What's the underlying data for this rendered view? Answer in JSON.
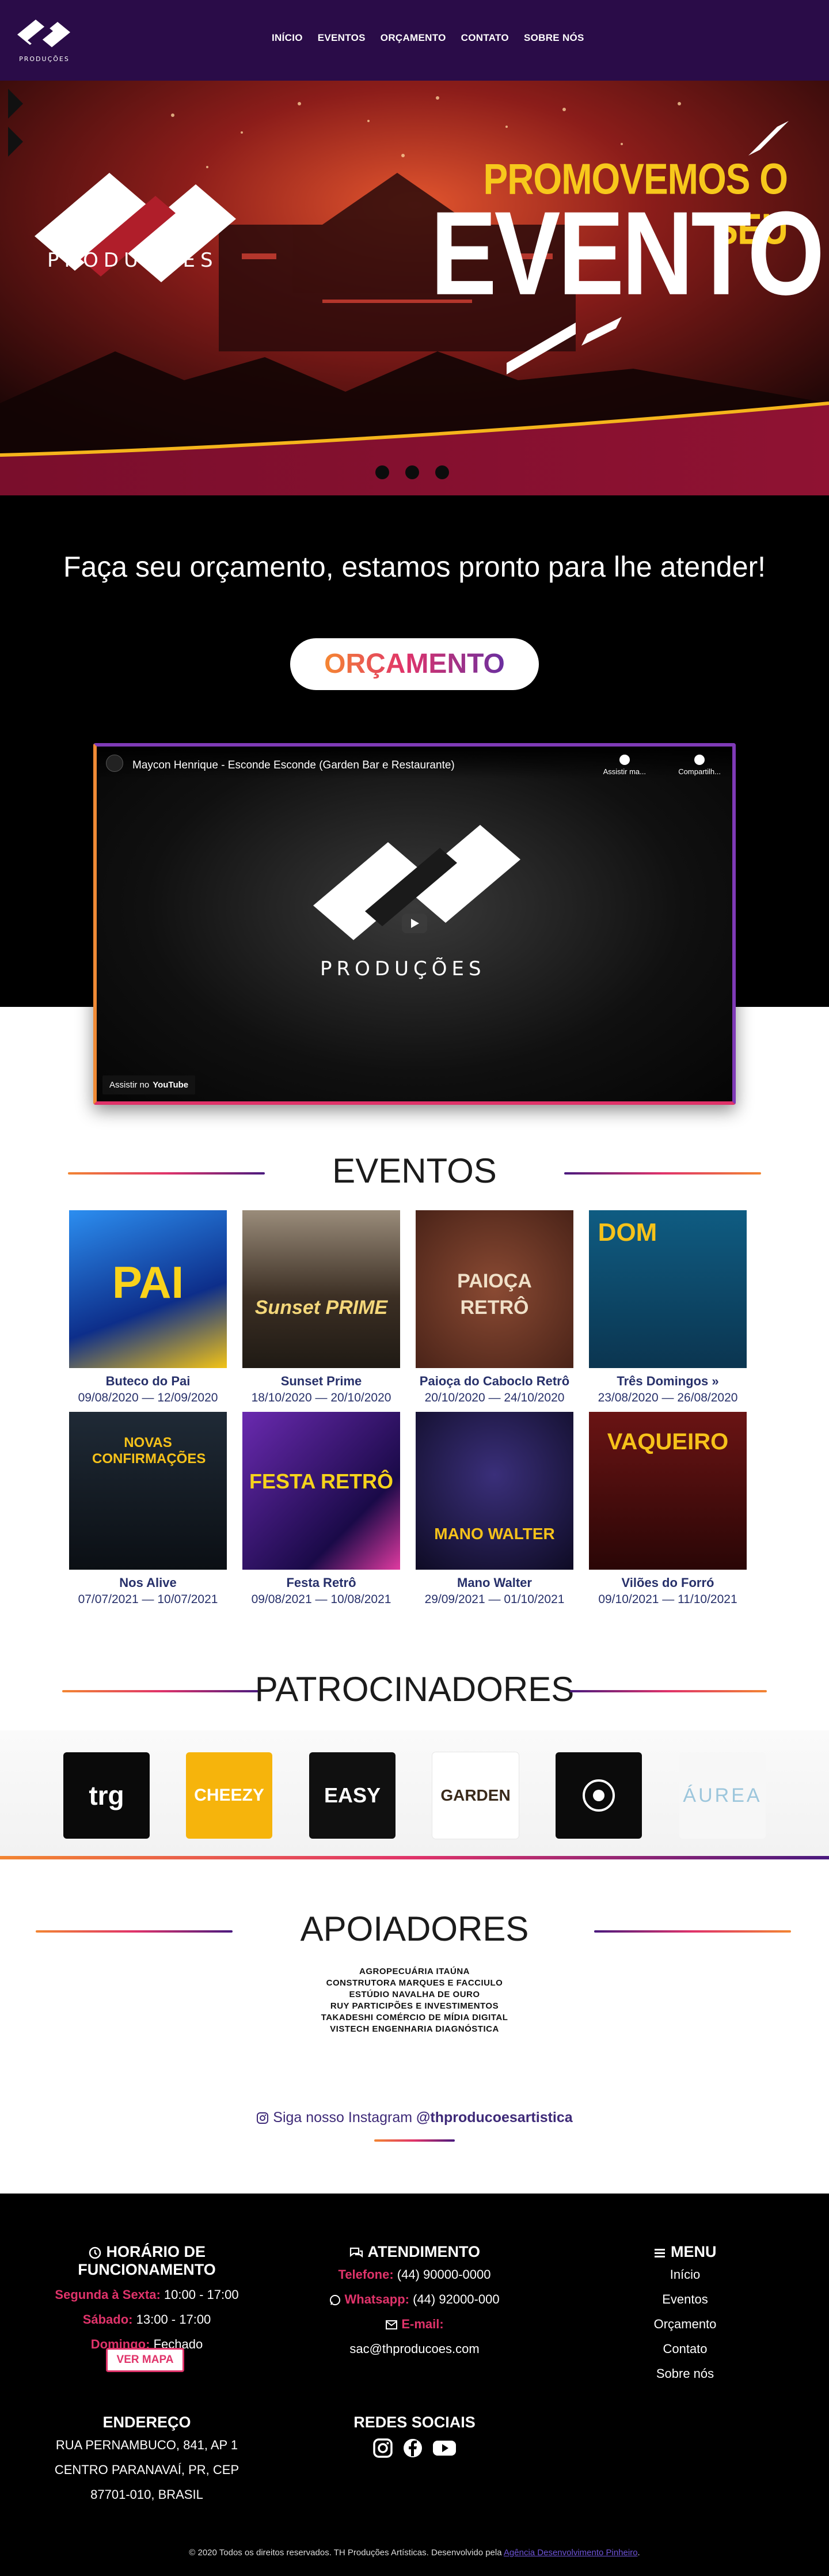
{
  "nav": {
    "logo_text": "PRODUÇÕES",
    "items": [
      "INÍCIO",
      "EVENTOS",
      "ORÇAMENTO",
      "CONTATO",
      "SOBRE NÓS"
    ]
  },
  "hero": {
    "brand": "PRODUÇÕES",
    "headline": "PROMOVEMOS O SEU",
    "headline_big": "EVENTO",
    "slides": 3
  },
  "cta": {
    "lead": "Faça seu orçamento, estamos pronto para lhe atender!",
    "button": "ORÇAMENTO"
  },
  "video": {
    "title": "Maycon Henrique - Esconde Esconde (Garden Bar e Restaurante)",
    "watch_later": "Assistir ma...",
    "share": "Compartilh...",
    "brand": "PRODUÇÕES",
    "watch_on": "Assistir no",
    "youtube": "YouTube"
  },
  "events": {
    "heading": "EVENTOS",
    "items": [
      {
        "name": "Buteco do Pai",
        "dates": "09/08/2020 — 12/09/2020",
        "poster": "PAI",
        "color": "#1f6fd0"
      },
      {
        "name": "Sunset Prime",
        "dates": "18/10/2020 — 20/10/2020",
        "poster": "Sunset PRIME",
        "color": "#4a3a2c"
      },
      {
        "name": "Paioça do Caboclo Retrô",
        "dates": "20/10/2020 — 24/10/2020",
        "poster": "PAIOÇA RETRÔ",
        "color": "#6b3a2a"
      },
      {
        "name": "Três Domingos »",
        "dates": "23/08/2020 — 26/08/2020",
        "poster": "DOM",
        "color": "#124b6b"
      },
      {
        "name": "Nos Alive",
        "dates": "07/07/2021 — 10/07/2021",
        "poster": "NOVAS CONFIRMAÇÕES",
        "color": "#15202b"
      },
      {
        "name": "Festa Retrô",
        "dates": "09/08/2021 — 10/08/2021",
        "poster": "FESTA RETRÔ",
        "color": "#3a1a6a"
      },
      {
        "name": "Mano Walter",
        "dates": "29/09/2021 — 01/10/2021",
        "poster": "MANO WALTER",
        "color": "#1a1436"
      },
      {
        "name": "Vilões do Forró",
        "dates": "09/10/2021 — 11/10/2021",
        "poster": "VAQUEIRO",
        "color": "#4a1010"
      }
    ]
  },
  "sponsors": {
    "heading": "PATROCINADORES",
    "items": [
      {
        "name": "trg",
        "bg": "#0a0a0a",
        "fg": "#ffffff"
      },
      {
        "name": "CHEEZY",
        "bg": "#f6b40c",
        "fg": "#ffffff"
      },
      {
        "name": "EASY",
        "bg": "#101010",
        "fg": "#ffffff"
      },
      {
        "name": "GARDEN",
        "bg": "#ffffff",
        "fg": "#3a2a1a"
      },
      {
        "name": "",
        "bg": "#0b0b0b",
        "fg": "#ffffff"
      },
      {
        "name": "ÁUREA",
        "bg": "#f7f7f7",
        "fg": "#9cc6dc"
      }
    ]
  },
  "supporters": {
    "heading": "APOIADORES",
    "items": [
      "AGROPECUÁRIA ITAÚNA",
      "CONSTRUTORA MARQUES E FACCIULO",
      "ESTÚDIO NAVALHA DE OURO",
      "RUY PARTICIPÕES E INVESTIMENTOS",
      "TAKADESHI COMÉRCIO DE MÍDIA DIGITAL",
      "VISTECH ENGENHARIA DIAGNÓSTICA"
    ]
  },
  "instagram": {
    "prefix": "Siga nosso Instagram",
    "handle": "@thproducoesartistica"
  },
  "footer": {
    "hours_title": "HORÁRIO DE FUNCIONAMENTO",
    "hours": [
      {
        "day": "Segunda à Sexta:",
        "time": "10:00 - 17:00"
      },
      {
        "day": "Sábado:",
        "time": "13:00 - 17:00"
      },
      {
        "day": "Domingo:",
        "time": "Fechado"
      }
    ],
    "service_title": "ATENDIMENTO",
    "phone_label": "Telefone:",
    "phone": "(44) 90000-0000",
    "whatsapp_label": "Whatsapp:",
    "whatsapp": "(44) 92000-000",
    "email_label": "E-mail:",
    "email": "sac@thproducoes.com",
    "menu_title": "MENU",
    "menu": [
      "Início",
      "Eventos",
      "Orçamento",
      "Contato",
      "Sobre nós"
    ],
    "address_title": "ENDEREÇO",
    "address": [
      "RUA PERNAMBUCO, 841, AP 1",
      "CENTRO PARANAVAÍ, PR, CEP",
      "87701-010, BRASIL"
    ],
    "map_button": "VER MAPA",
    "social_title": "REDES SOCIAIS",
    "copyright": "© 2020 Todos os direitos reservados. TH Produções Artísticas. Desenvolvido pela",
    "agency": "Agência Desenvolvimento Pinheiro"
  }
}
